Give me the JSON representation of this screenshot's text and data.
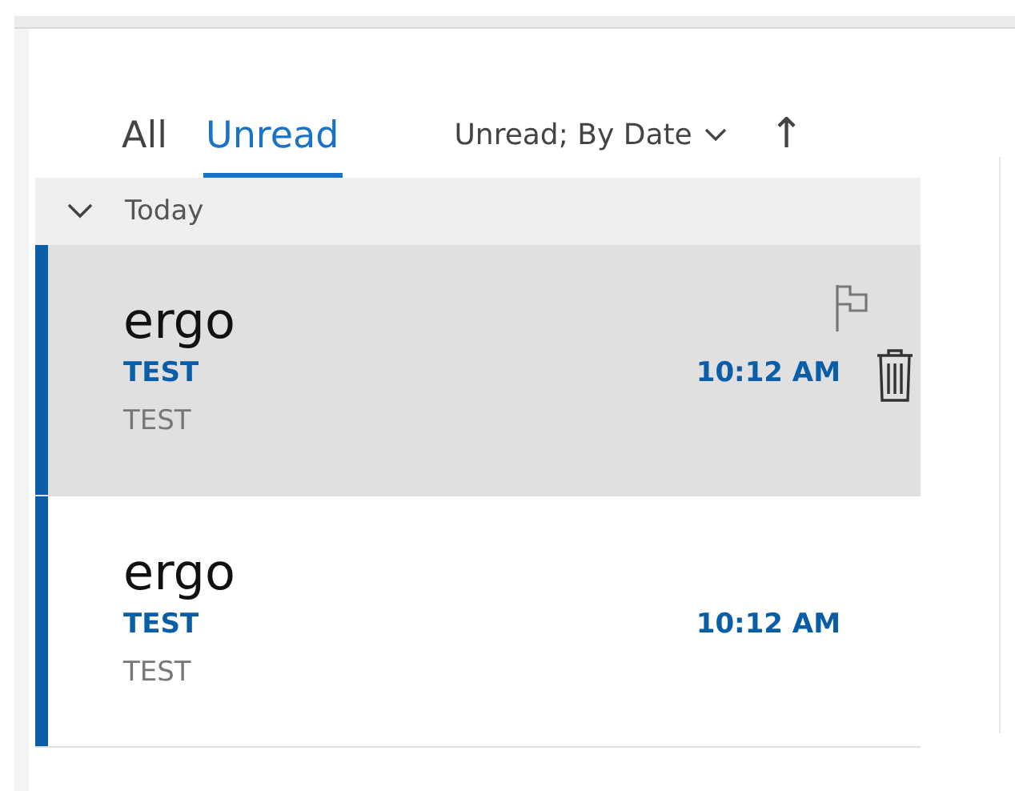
{
  "tabs": [
    {
      "label": "All",
      "selected": false
    },
    {
      "label": "Unread",
      "selected": true
    }
  ],
  "sort": {
    "label": "Unread; By Date",
    "arrow": "↑"
  },
  "group": {
    "label": "Today",
    "expanded": true
  },
  "messages": [
    {
      "sender": "ergo",
      "subject": "TEST",
      "time": "10:12 AM",
      "preview": "TEST",
      "unread": true,
      "selected": true
    },
    {
      "sender": "ergo",
      "subject": "TEST",
      "time": "10:12 AM",
      "preview": "TEST",
      "unread": true,
      "selected": false
    }
  ]
}
